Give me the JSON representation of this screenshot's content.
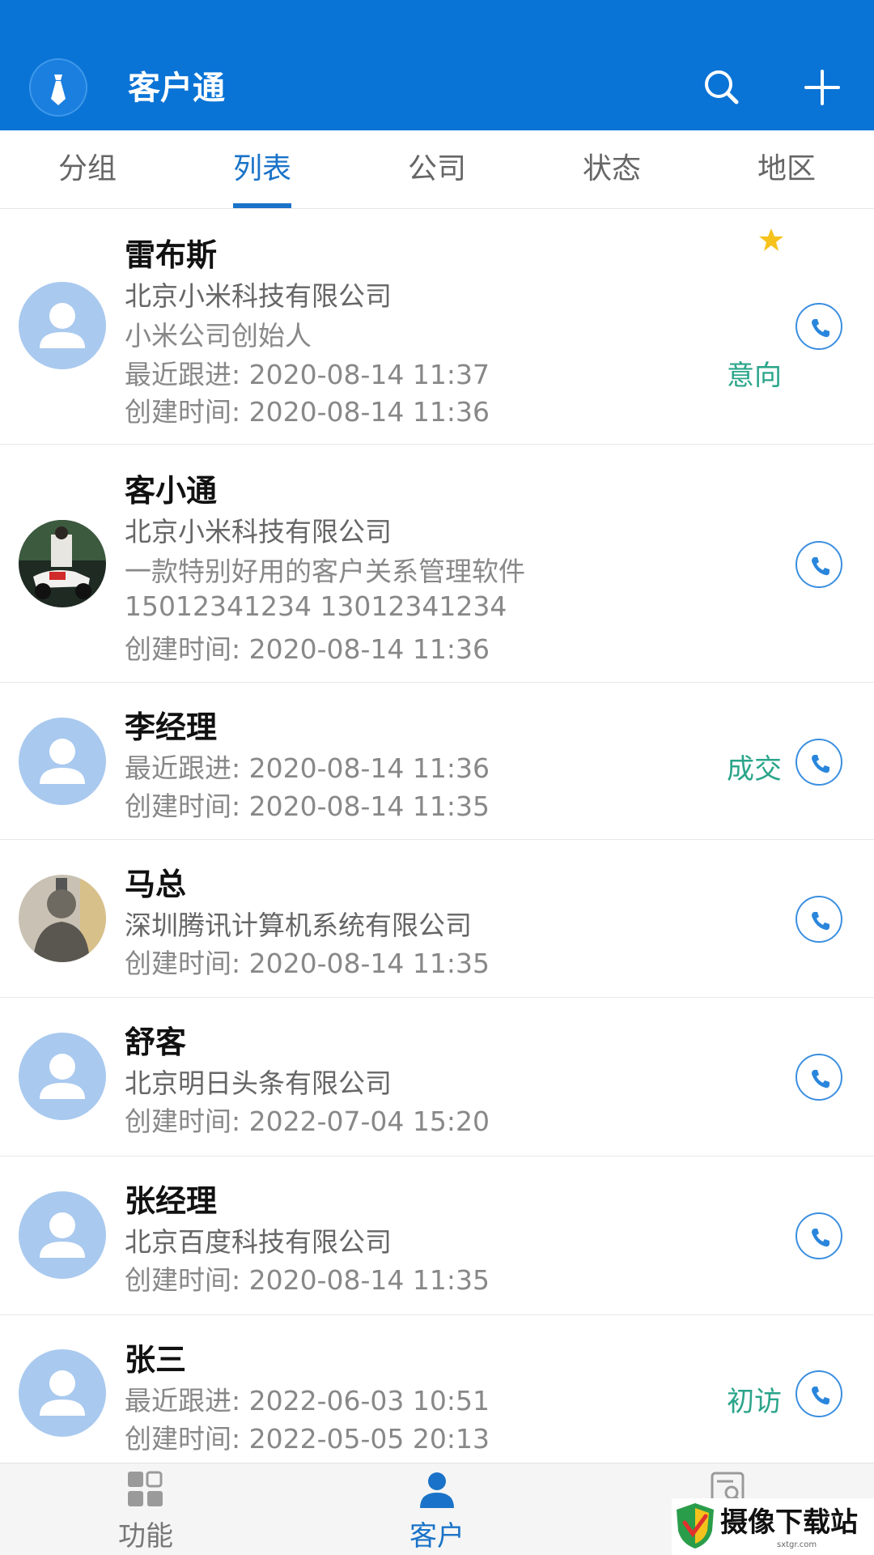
{
  "header": {
    "title": "客户通",
    "background_color": "#0a74d6",
    "logo_icon": "tie-icon",
    "search_icon": "search-icon",
    "add_icon": "plus-icon"
  },
  "tabs": [
    {
      "label": "分组",
      "active": false
    },
    {
      "label": "列表",
      "active": true
    },
    {
      "label": "公司",
      "active": false
    },
    {
      "label": "状态",
      "active": false
    },
    {
      "label": "地区",
      "active": false
    }
  ],
  "customers": [
    {
      "name": "雷布斯",
      "company": "北京小米科技有限公司",
      "note": "小米公司创始人",
      "follow": "最近跟进: 2020-08-14 11:37",
      "created": "创建时间: 2020-08-14 11:36",
      "status": "意向",
      "starred": true,
      "avatar": "default-avatar"
    },
    {
      "name": "客小通",
      "company": "北京小米科技有限公司",
      "note": "一款特别好用的客户关系管理软件",
      "phones": "15012341234 13012341234",
      "created": "创建时间: 2020-08-14 11:36",
      "avatar": "photo-avatar-scooter"
    },
    {
      "name": "李经理",
      "follow": "最近跟进: 2020-08-14 11:36",
      "created": "创建时间: 2020-08-14 11:35",
      "status": "成交",
      "avatar": "default-avatar"
    },
    {
      "name": "马总",
      "company": "深圳腾讯计算机系统有限公司",
      "created": "创建时间: 2020-08-14 11:35",
      "avatar": "photo-avatar-statue"
    },
    {
      "name": "舒客",
      "company": "北京明日头条有限公司",
      "created": "创建时间: 2022-07-04 15:20",
      "avatar": "default-avatar"
    },
    {
      "name": "张经理",
      "company": "北京百度科技有限公司",
      "created": "创建时间: 2020-08-14 11:35",
      "avatar": "default-avatar"
    },
    {
      "name": "张三",
      "follow": "最近跟进: 2022-06-03 10:51",
      "created": "创建时间: 2022-05-05 20:13",
      "status": "初访",
      "avatar": "default-avatar"
    }
  ],
  "bottom_nav": [
    {
      "label": "功能",
      "icon": "grid-icon",
      "active": false
    },
    {
      "label": "客户",
      "icon": "person-icon",
      "active": true
    },
    {
      "label": "",
      "icon": "search-doc-icon",
      "active": false
    }
  ],
  "watermark": {
    "text": "摄像下载站",
    "sub": "sxtgr.com"
  },
  "colors": {
    "accent": "#1a73c8",
    "status_green": "#2aa58a",
    "avatar_default": "#a9c9ef"
  }
}
